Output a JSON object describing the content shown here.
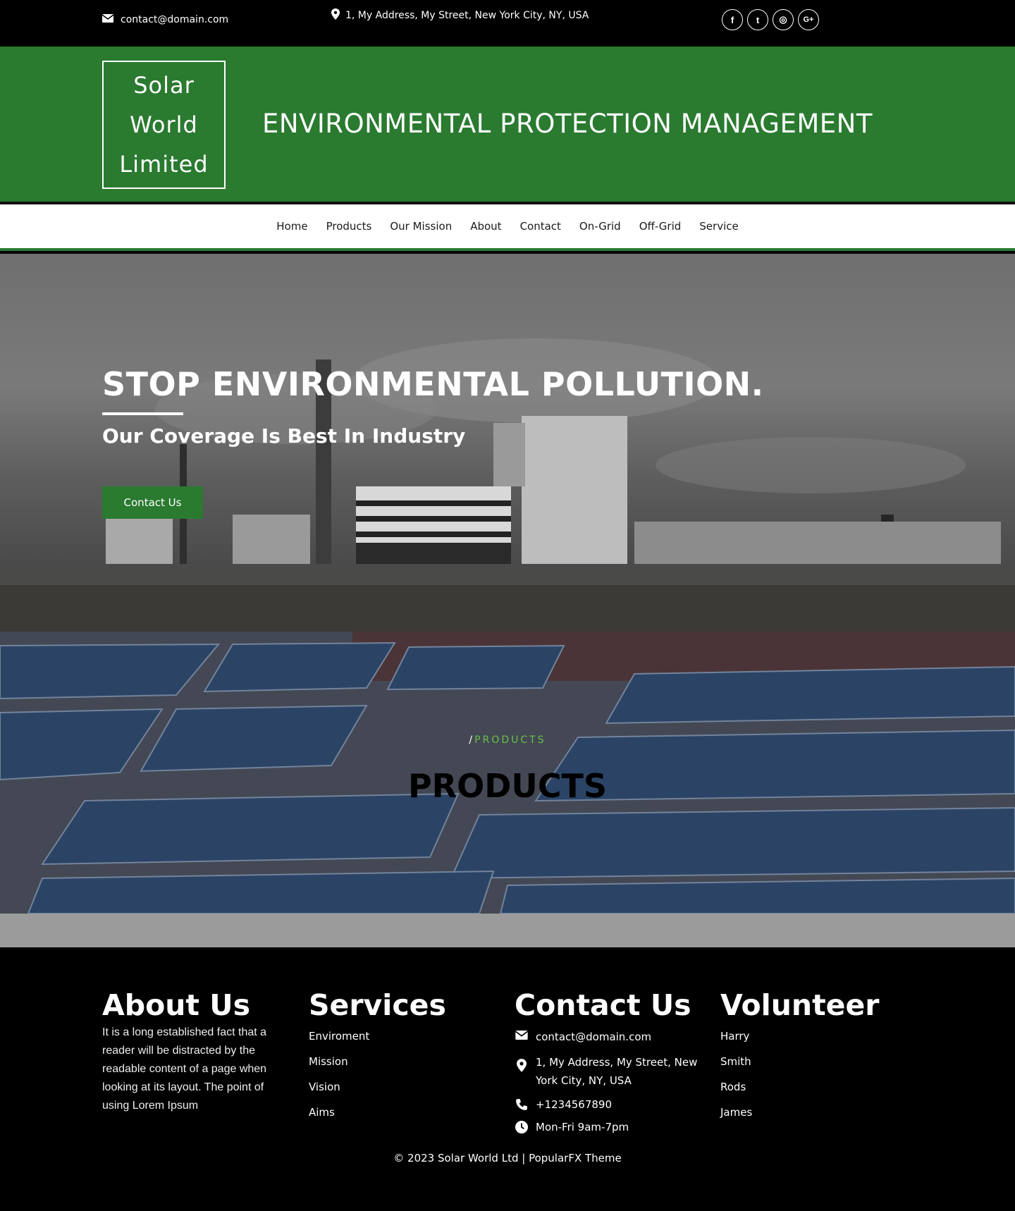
{
  "topbar": {
    "email": "contact@domain.com",
    "address": "1, My Address, My Street, New York City, NY, USA",
    "social": [
      {
        "icon": "facebook-icon",
        "glyph": "f"
      },
      {
        "icon": "twitter-icon",
        "glyph": "t"
      },
      {
        "icon": "instagram-icon",
        "glyph": "◎"
      },
      {
        "icon": "google-plus-icon",
        "glyph": "G+"
      }
    ]
  },
  "brand": {
    "logo_lines": [
      "Solar",
      "World",
      "Limited"
    ],
    "tagline": "ENVIRONMENTAL PROTECTION MANAGEMENT"
  },
  "nav": {
    "items": [
      "Home",
      "Products",
      "Our Mission",
      "About",
      "Contact",
      "On-Grid",
      "Off-Grid",
      "Service"
    ]
  },
  "hero": {
    "title": "STOP ENVIRONMENTAL POLLUTION.",
    "subtitle": "Our Coverage Is Best In Industry",
    "button": "Contact Us"
  },
  "banner": {
    "crumb_sep": "/",
    "crumb_current": "PRODUCTS",
    "title": "PRODUCTS"
  },
  "footer": {
    "about": {
      "heading": "About Us",
      "text": "It is a long established fact that a reader will be distracted by the readable content of a page when looking at its layout. The point of using Lorem Ipsum"
    },
    "services": {
      "heading": "Services",
      "links": [
        "Enviroment",
        "Mission",
        "Vision",
        "Aims"
      ]
    },
    "contact": {
      "heading": "Contact Us",
      "email": "contact@domain.com",
      "address": "1, My Address, My Street, New York City, NY, USA",
      "phone": "+1234567890",
      "hours": "Mon-Fri 9am-7pm"
    },
    "volunteer": {
      "heading": "Volunteer",
      "links": [
        "Harry",
        "Smith",
        "Rods",
        "James"
      ]
    },
    "copyright": "© 2023 Solar World Ltd | PopularFX Theme"
  },
  "colors": {
    "brand_green": "#2a7a30",
    "accent_green": "#6cc04a"
  }
}
